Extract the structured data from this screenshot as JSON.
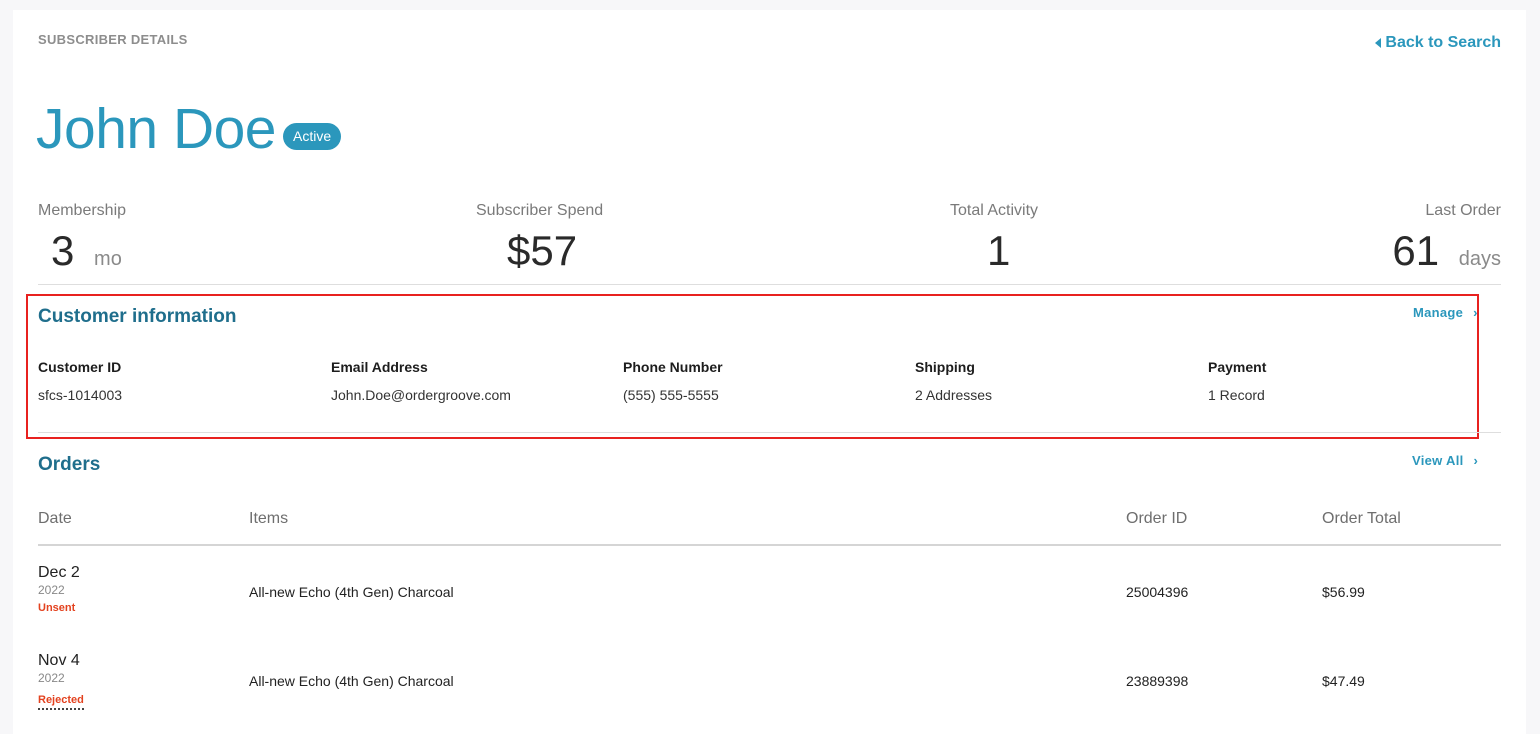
{
  "header": {
    "section_title": "SUBSCRIBER DETAILS",
    "back_link": "Back to Search"
  },
  "subscriber": {
    "name": "John Doe",
    "status": "Active"
  },
  "stats": [
    {
      "label": "Membership",
      "value": "3",
      "unit": "mo"
    },
    {
      "label": "Subscriber Spend",
      "value": "$57",
      "unit": ""
    },
    {
      "label": "Total Activity",
      "value": "1",
      "unit": ""
    },
    {
      "label": "Last Order",
      "value": "61",
      "unit": "days"
    }
  ],
  "customer_info": {
    "title": "Customer information",
    "manage_label": "Manage",
    "fields": [
      {
        "label": "Customer ID",
        "value": "sfcs-1014003"
      },
      {
        "label": "Email Address",
        "value": "John.Doe@ordergroove.com"
      },
      {
        "label": "Phone Number",
        "value": "(555) 555-5555"
      },
      {
        "label": "Shipping",
        "value": "2 Addresses"
      },
      {
        "label": "Payment",
        "value": "1 Record"
      }
    ]
  },
  "orders": {
    "title": "Orders",
    "view_all_label": "View All",
    "columns": [
      "Date",
      "Items",
      "Order ID",
      "Order Total"
    ],
    "rows": [
      {
        "date": "Dec 2",
        "year": "2022",
        "status": "Unsent",
        "item": "All-new Echo (4th Gen) Charcoal",
        "order_id": "25004396",
        "total": "$56.99"
      },
      {
        "date": "Nov 4",
        "year": "2022",
        "status": "Rejected",
        "item": "All-new Echo (4th Gen) Charcoal",
        "order_id": "23889398",
        "total": "$47.49"
      }
    ]
  },
  "colors": {
    "accent": "#2b97bc",
    "heading": "#1f6e8c",
    "status_error": "#e3421f",
    "highlight_border": "#e8211f"
  },
  "icons": {
    "back": "caret-left-icon",
    "chevron": "chevron-right-icon"
  }
}
